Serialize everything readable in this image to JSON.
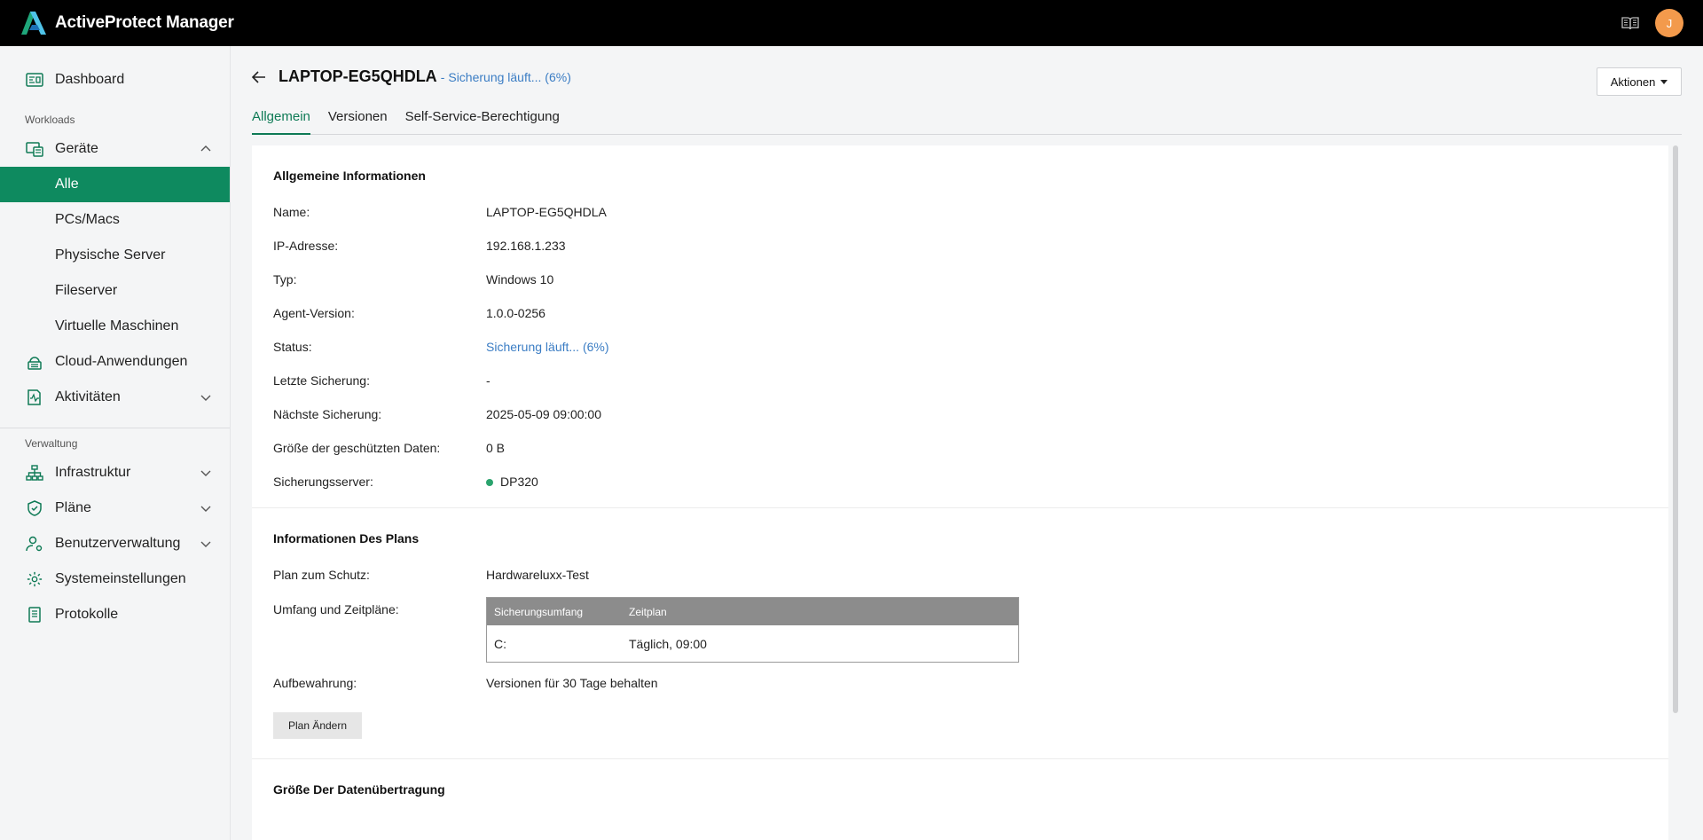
{
  "app": {
    "title": "ActiveProtect Manager",
    "avatar_initial": "J",
    "accent_color": "#0e8a5f",
    "link_color": "#3b7dc4"
  },
  "sidebar": {
    "dashboard": "Dashboard",
    "workloads_label": "Workloads",
    "devices": "Geräte",
    "devices_sub": [
      "Alle",
      "PCs/Macs",
      "Physische Server",
      "Fileserver",
      "Virtuelle Maschinen"
    ],
    "cloud_apps": "Cloud-Anwendungen",
    "activities": "Aktivitäten",
    "management_label": "Verwaltung",
    "infrastructure": "Infrastruktur",
    "plans": "Pläne",
    "user_mgmt": "Benutzerverwaltung",
    "system_settings": "Systemeinstellungen",
    "logs": "Protokolle"
  },
  "header": {
    "device_name": "LAPTOP-EG5QHDLA",
    "separator": "-",
    "status": "Sicherung läuft... (6%)",
    "actions_label": "Aktionen"
  },
  "tabs": [
    "Allgemein",
    "Versionen",
    "Self-Service-Berechtigung"
  ],
  "general_info": {
    "heading": "Allgemeine Informationen",
    "rows": [
      {
        "label": "Name:",
        "value": "LAPTOP-EG5QHDLA"
      },
      {
        "label": "IP-Adresse:",
        "value": "192.168.1.233"
      },
      {
        "label": "Typ:",
        "value": "Windows 10"
      },
      {
        "label": "Agent-Version:",
        "value": "1.0.0-0256"
      },
      {
        "label": "Status:",
        "value": "Sicherung läuft... (6%)"
      },
      {
        "label": "Letzte Sicherung:",
        "value": "-"
      },
      {
        "label": "Nächste Sicherung:",
        "value": "2025-05-09 09:00:00"
      },
      {
        "label": "Größe der geschützten Daten:",
        "value": "0 B"
      },
      {
        "label": "Sicherungsserver:",
        "value": "DP320"
      }
    ]
  },
  "plan_info": {
    "heading": "Informationen Des Plans",
    "plan_label": "Plan zum Schutz:",
    "plan_value": "Hardwareluxx-Test",
    "scope_label": "Umfang und Zeitpläne:",
    "table_headers": [
      "Sicherungsumfang",
      "Zeitplan"
    ],
    "table_rows": [
      [
        "C:",
        "Täglich, 09:00"
      ]
    ],
    "retention_label": "Aufbewahrung:",
    "retention_value": "Versionen für 30 Tage behalten",
    "change_plan_button": "Plan Ändern"
  },
  "transfer": {
    "heading": "Größe Der Datenübertragung"
  }
}
